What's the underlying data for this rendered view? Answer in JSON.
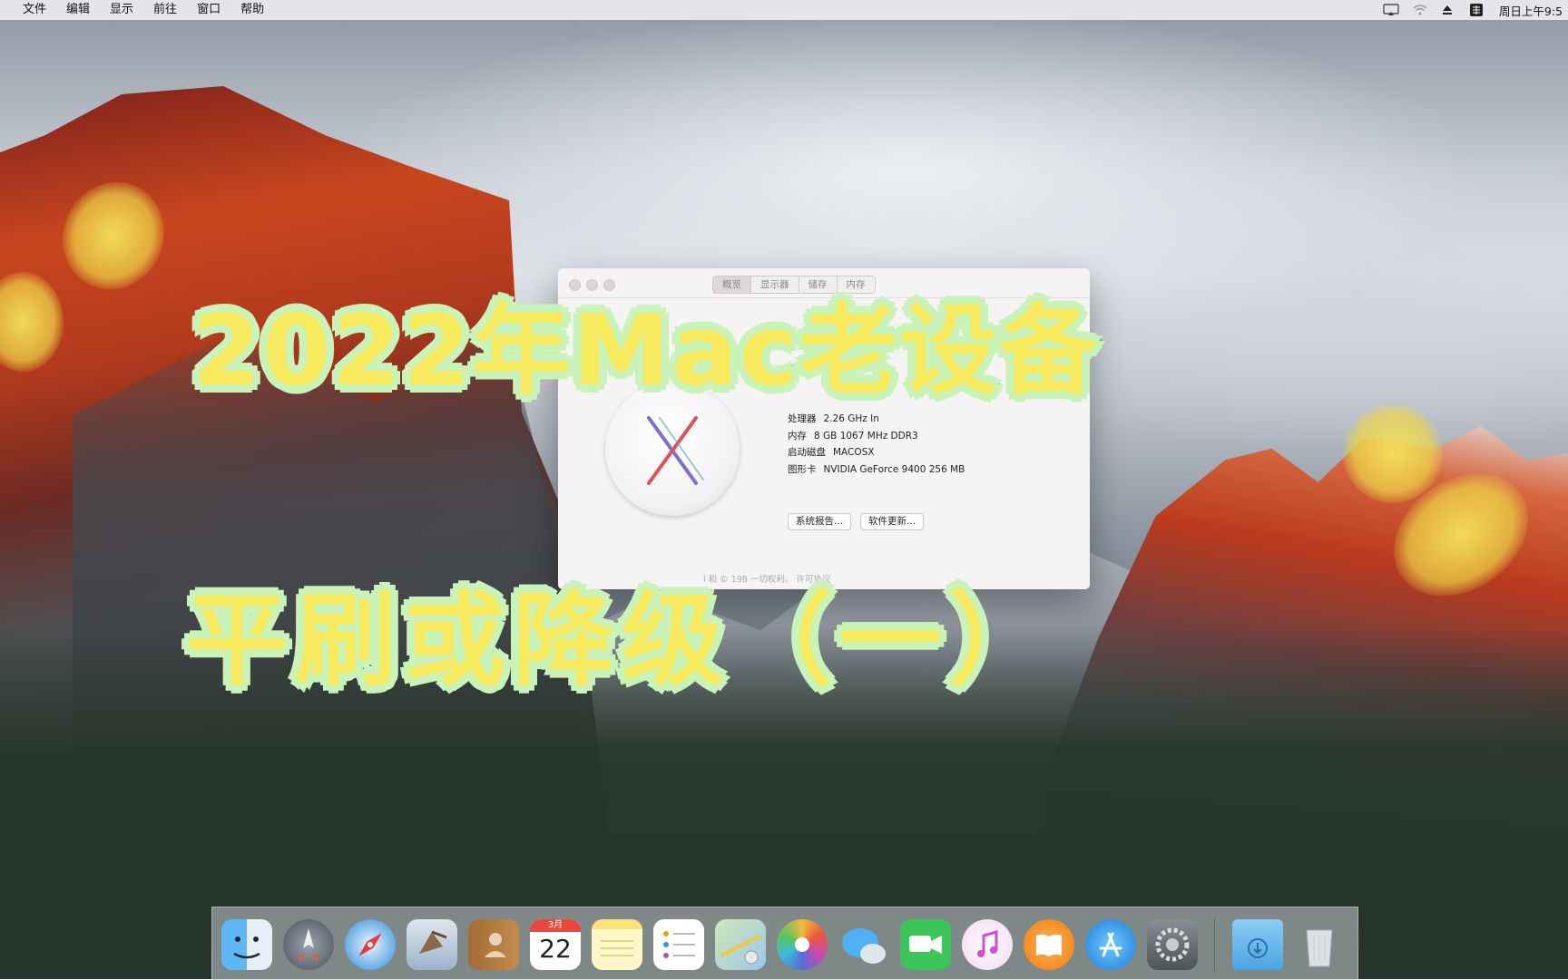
{
  "menubar": {
    "items": [
      "文件",
      "编辑",
      "显示",
      "前往",
      "窗口",
      "帮助"
    ],
    "clock": "周日上午9:5"
  },
  "about_window": {
    "tabs": [
      "概览",
      "显示器",
      "储存",
      "内存"
    ],
    "specs": [
      {
        "label": "处理器",
        "value": "2.26 GHz In"
      },
      {
        "label": "内存",
        "value": "8 GB 1067 MHz DDR3"
      },
      {
        "label": "启动磁盘",
        "value": "MACOSX"
      },
      {
        "label": "图形卡",
        "value": "NVIDIA GeForce 9400 256 MB"
      }
    ],
    "buttons": {
      "system_report": "系统报告...",
      "software_update": "软件更新..."
    },
    "legal": "l 和 © 198          一切权利。  许可协议"
  },
  "overlay": {
    "line1": "2022年Mac老设备",
    "line2": "平刷或降级（一）"
  },
  "dock": {
    "calendar_month": "3月",
    "calendar_day": "22",
    "icons": [
      "finder-icon",
      "launchpad-icon",
      "safari-icon",
      "mail-icon",
      "contacts-icon",
      "calendar-icon",
      "notes-icon",
      "reminders-icon",
      "maps-icon",
      "photos-icon",
      "messages-icon",
      "facetime-icon",
      "itunes-icon",
      "ibooks-icon",
      "app-store-icon",
      "system-preferences-icon",
      "downloads-folder-icon",
      "trash-icon"
    ]
  },
  "colors": {
    "overlay_fill": "#f8ea5e",
    "overlay_stroke": "#5fbd52"
  }
}
